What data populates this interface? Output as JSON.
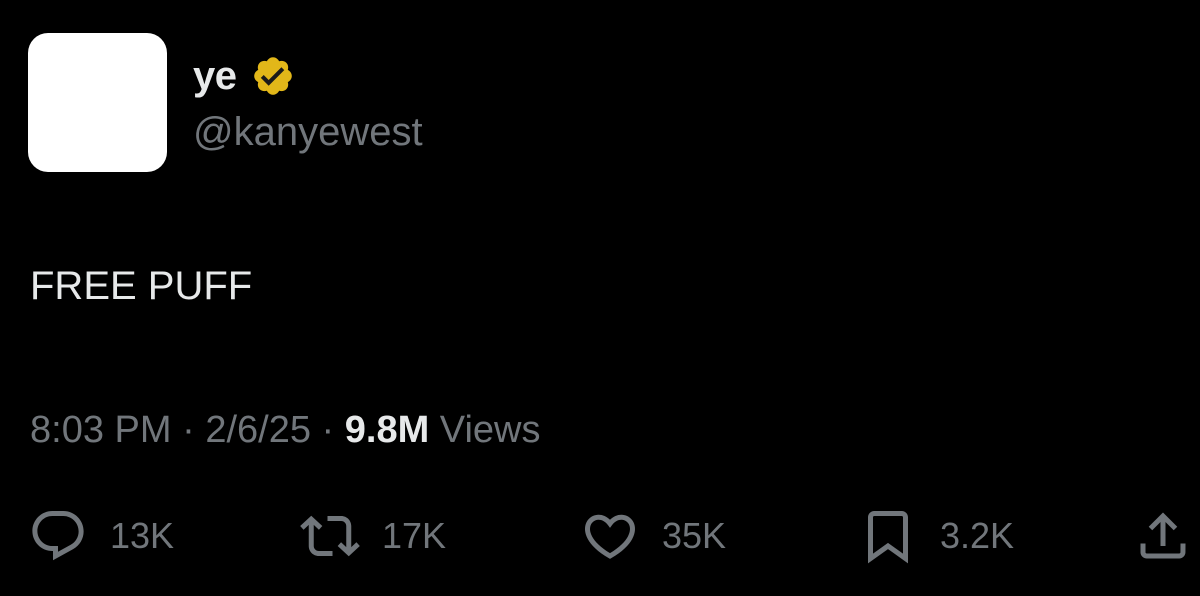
{
  "author": {
    "name": "ye",
    "handle": "@kanyewest",
    "verified": true
  },
  "tweet": {
    "text": "FREE PUFF",
    "time": "8:03 PM",
    "separator": "·",
    "date": "2/6/25",
    "views_count": "9.8M",
    "views_label": "Views"
  },
  "actions": {
    "replies": "13K",
    "retweets": "17K",
    "likes": "35K",
    "bookmarks": "3.2K"
  },
  "icons": {
    "reply": "reply-icon",
    "retweet": "retweet-icon",
    "like": "heart-icon",
    "bookmark": "bookmark-icon",
    "share": "share-icon",
    "verified": "verified-badge-icon"
  },
  "colors": {
    "background": "#000000",
    "text_primary": "#e7e9ea",
    "text_secondary": "#71767b",
    "verified_gold": "#e2b719",
    "avatar": "#ffffff"
  }
}
